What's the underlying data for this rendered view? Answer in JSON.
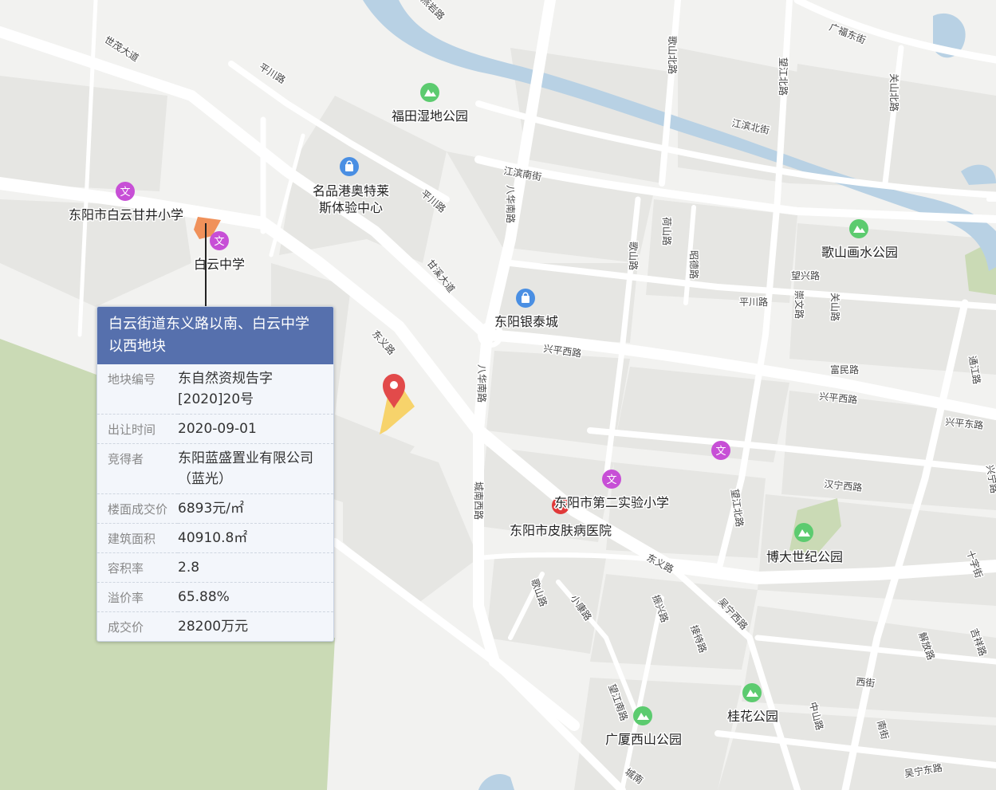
{
  "colors": {
    "water": "#b8d1e4",
    "park": "#cadab5",
    "road": "#ffffff",
    "block": "#e6e6e3",
    "popup_header": "#5670ad",
    "pin": "#e24a4a",
    "parcel": "#f7d36b",
    "highlight": "#f0915a"
  },
  "pois": [
    {
      "id": "futian",
      "label": "福田湿地公园",
      "icon": "park-icon"
    },
    {
      "id": "mingpin",
      "label": "名品港奥特莱",
      "label2": "斯体验中心",
      "icon": "shopping-bag-icon"
    },
    {
      "id": "baiyun-ganjing",
      "label": "东阳市白云甘井小学",
      "icon": "school-icon"
    },
    {
      "id": "baiyun-zhongxue",
      "label": "白云中学",
      "icon": "school-icon"
    },
    {
      "id": "yintai",
      "label": "东阳银泰城",
      "icon": "shopping-bag-icon"
    },
    {
      "id": "geshan-park",
      "label": "歌山画水公园",
      "icon": "park-icon"
    },
    {
      "id": "school2",
      "label": "东阳市第二实验小学",
      "icon": "school-icon"
    },
    {
      "id": "skin-hospital",
      "label": "东阳市皮肤病医院",
      "icon": "hospital-icon"
    },
    {
      "id": "boda",
      "label": "博大世纪公园",
      "icon": "park-icon"
    },
    {
      "id": "guihua",
      "label": "桂花公园",
      "icon": "park-icon"
    },
    {
      "id": "guangsha",
      "label": "广厦西山公园",
      "icon": "park-icon"
    },
    {
      "id": "school3",
      "label": "",
      "icon": "school-icon"
    }
  ],
  "roads": [
    "世茂大道",
    "平川路",
    "平川路",
    "甘溪大道",
    "东义路",
    "江滨南街",
    "江滨北街",
    "广福东街",
    "歌山北路",
    "望江北路",
    "关山北路",
    "八华南路",
    "荷山路",
    "歌山路",
    "昭德路",
    "望兴路",
    "平川路",
    "崇文路",
    "关山路",
    "兴平西路",
    "兴平西路",
    "富民路",
    "兴平东路",
    "通江路",
    "八华南路",
    "城南西路",
    "汉宁西路",
    "兴宁路",
    "望江北路",
    "东义路",
    "吴宁西路",
    "十字街",
    "歌山路",
    "小康路",
    "振兴路",
    "接待路",
    "望江南路",
    "解放路",
    "吉祥路",
    "西街",
    "中山路",
    "南街",
    "吴宁东路",
    "城南",
    "燕岩路"
  ],
  "popup": {
    "title": "白云街道东义路以南、白云中学以西地块",
    "rows": [
      {
        "key": "地块编号",
        "value": "东自然资规告字[2020]20号"
      },
      {
        "key": "出让时间",
        "value": "2020-09-01"
      },
      {
        "key": "竞得者",
        "value": "东阳蓝盛置业有限公司（蓝光）"
      },
      {
        "key": "楼面成交价",
        "value": "6893元/㎡"
      },
      {
        "key": "建筑面积",
        "value": "40910.8㎡"
      },
      {
        "key": "容积率",
        "value": "2.8"
      },
      {
        "key": "溢价率",
        "value": "65.88%"
      },
      {
        "key": "成交价",
        "value": "28200万元"
      }
    ]
  }
}
